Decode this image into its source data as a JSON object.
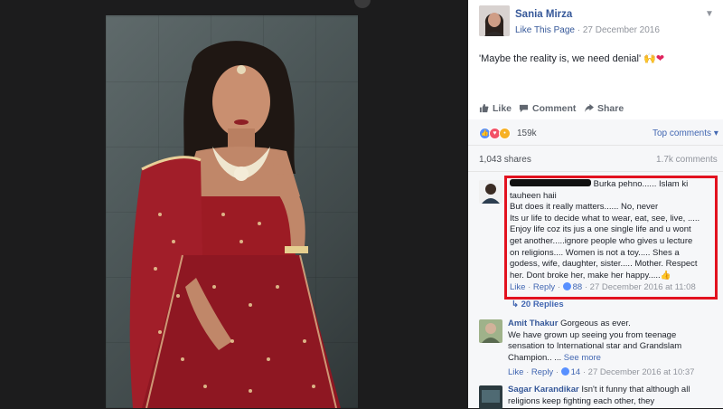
{
  "theme": {
    "accent": "#365899",
    "link": "#4267b2",
    "highlight": "#e2121f",
    "heart": "#e0245e"
  },
  "photo": {
    "icon": "photo-of-woman-in-red-bridal-lehenga"
  },
  "post": {
    "author": "Sania Mirza",
    "like_page": "Like This Page",
    "separator": "·",
    "date": "27 December 2016",
    "text": "'Maybe the reality is, we need denial'",
    "emoji_text": "🙌"
  },
  "actions": {
    "like": "Like",
    "comment": "Comment",
    "share": "Share"
  },
  "stats": {
    "reactions_count": "159k",
    "top_comments": "Top comments",
    "shares": "1,043 shares",
    "comments": "1.7k comments"
  },
  "comments": [
    {
      "name_redacted": true,
      "text_lines": [
        "Burka pehno...... Islam ki",
        "tauheen haii",
        "But does it really matters...... No, never",
        "Its ur life to decide what to wear, eat, see, live, .....",
        "Enjoy life coz its jus a one single life and u wont",
        "get another.....ignore people who gives u lecture",
        "on religions.... Women is not a toy..... Shes a",
        "godess, wife, daughter, sister..... Mother. Respect",
        "her. Dont broke her, make her happy....."
      ],
      "emoji": "👍",
      "like": "Like",
      "reply": "Reply",
      "reactions": "88",
      "time": "27 December 2016 at 11:08",
      "replies_label": "20 Replies"
    },
    {
      "author": "Amit Thakur",
      "text_lines": [
        "Gorgeous as ever.",
        "We have grown up seeing you from teenage",
        "sensation to International star and Grandslam",
        "Champion.. ..."
      ],
      "see_more": "See more",
      "like": "Like",
      "reply": "Reply",
      "reactions": "14",
      "time": "27 December 2016 at 10:37"
    },
    {
      "author": "Sagar Karandikar",
      "text_lines": [
        "Isn't it funny that although all",
        "religions keep fighting each other, they"
      ]
    }
  ]
}
